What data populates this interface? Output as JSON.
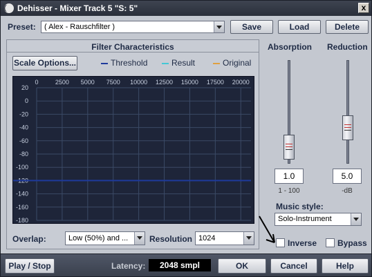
{
  "window": {
    "title": "Dehisser - Mixer Track 5 \"S: 5\"",
    "close_glyph": "x"
  },
  "preset": {
    "label": "Preset:",
    "value": "( Alex - Rauschfilter )",
    "save": "Save",
    "load": "Load",
    "delete": "Delete"
  },
  "filter": {
    "title": "Filter Characteristics",
    "scale_options": "Scale Options...",
    "legend": [
      {
        "label": "Threshold",
        "color": "#1e3a9c"
      },
      {
        "label": "Result",
        "color": "#44c7d6"
      },
      {
        "label": "Original",
        "color": "#e0a040"
      }
    ],
    "x_ticks": [
      "0",
      "2500",
      "5000",
      "7500",
      "10000",
      "12500",
      "15000",
      "17500",
      "20000"
    ],
    "y_ticks": [
      "20",
      "0",
      "-20",
      "-40",
      "-60",
      "-80",
      "-100",
      "-120",
      "-140",
      "-160",
      "-180"
    ],
    "threshold_db": -120,
    "overlap_label": "Overlap:",
    "overlap_value": "Low (50%) and ...",
    "resolution_label": "Resolution",
    "resolution_value": "1024"
  },
  "absorption": {
    "label": "Absorption",
    "value": "1.0",
    "unit": "1 - 100",
    "level": 0.0
  },
  "reduction": {
    "label": "Reduction",
    "value": "5.0",
    "unit": "-dB",
    "level": 0.25
  },
  "music_style": {
    "label": "Music style:",
    "value": "Solo-Instrument"
  },
  "inverse": {
    "label": "Inverse",
    "checked": false
  },
  "bypass": {
    "label": "Bypass",
    "checked": false
  },
  "bottom": {
    "play_stop": "Play / Stop",
    "latency_label": "Latency:",
    "latency_value": "2048 smpl",
    "ok": "OK",
    "cancel": "Cancel",
    "help": "Help"
  },
  "colors": {
    "graph_bg": "#1e2539",
    "grid": "#3b4a66",
    "threshold": "#1e3a9c"
  }
}
